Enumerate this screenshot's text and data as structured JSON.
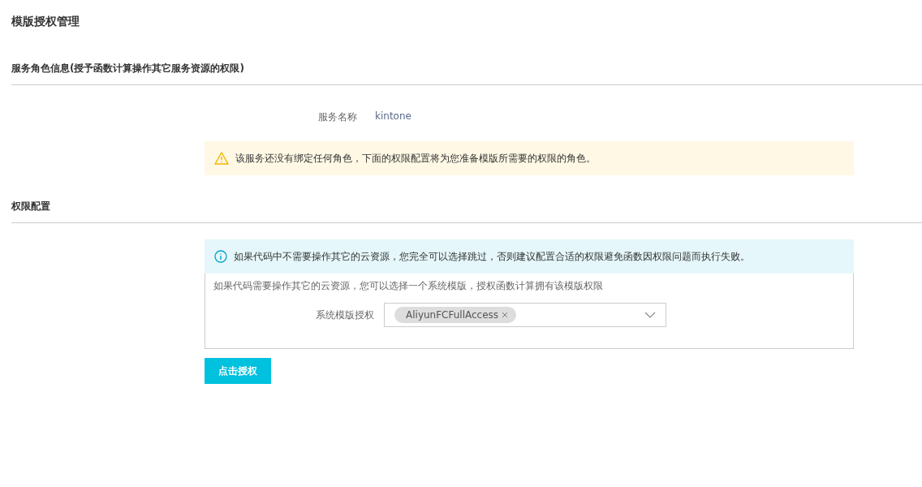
{
  "page_title": "模版授权管理",
  "service_section": {
    "heading": "服务角色信息(授予函数计算操作其它服务资源的权限)",
    "field": {
      "label": "服务名称",
      "value": "kintone"
    },
    "alert": {
      "kind": "warning",
      "text": "该服务还没有绑定任何角色，下面的权限配置将为您准备模版所需要的权限的角色。"
    }
  },
  "permission_section": {
    "heading": "权限配置",
    "alert": {
      "kind": "info",
      "text": "如果代码中不需要操作其它的云资源，您完全可以选择跳过，否则建议配置合适的权限避免函数因权限问题而执行失败。"
    },
    "panel": {
      "description": "如果代码需要操作其它的云资源，您可以选择一个系统模版，授权函数计算拥有该模版权限",
      "select": {
        "label": "系统模版授权",
        "tags": [
          "AliyunFCFullAccess"
        ]
      }
    },
    "button": "点击授权"
  }
}
